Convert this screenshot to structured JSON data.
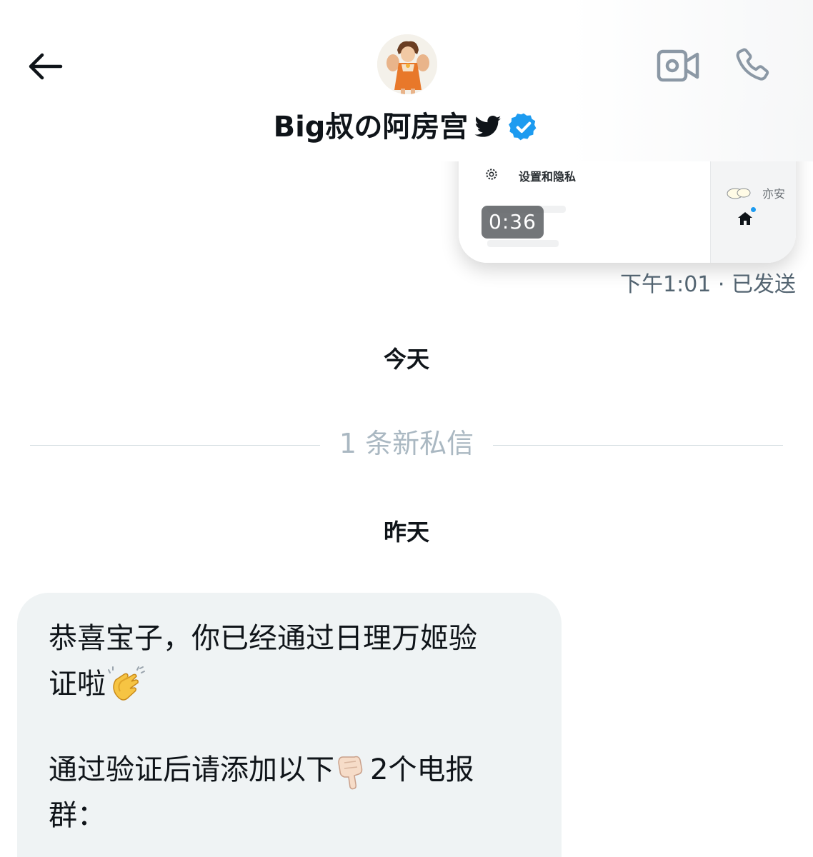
{
  "header": {
    "contact_name": "Big叔の阿房宫",
    "back_icon": "arrow-left-icon",
    "video_call_icon": "video-camera-icon",
    "phone_icon": "phone-icon",
    "verified": true,
    "accent_color": "#1d9bf0"
  },
  "shared_video": {
    "settings_label": "设置和隐私",
    "side_name": "亦安",
    "duration": "0:36",
    "meta": "下午1:01 · 已发送"
  },
  "separators": {
    "today": "今天",
    "new_messages": "1 条新私信",
    "yesterday": "昨天"
  },
  "incoming_message": {
    "line1": "恭喜宝子，你已经通过日理万姬验",
    "line2": "证啦",
    "line3": "通过验证后请添加以下",
    "line3b": "2个电报",
    "line4": "群："
  }
}
